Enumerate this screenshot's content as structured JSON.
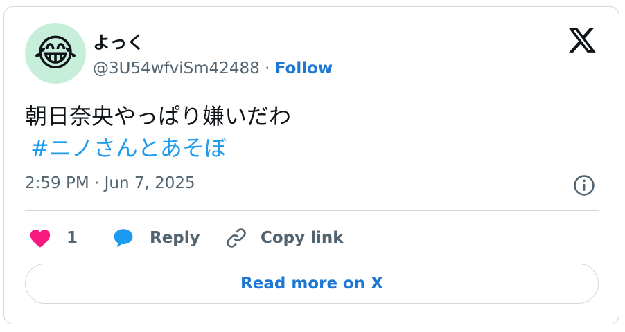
{
  "author": {
    "avatar_emoji": "😂",
    "avatar_bg": "#c6eedb",
    "display_name": "よっく",
    "handle": "@3U54wfviSm42488",
    "separator": " · ",
    "follow_label": "Follow"
  },
  "tweet": {
    "text": "朝日奈央やっぱり嫌いだわ",
    "hashtag": "#ニノさんとあそぼ",
    "timestamp": "2:59 PM · Jun 7, 2025"
  },
  "actions": {
    "like_count": "1",
    "reply_label": "Reply",
    "copy_link_label": "Copy link"
  },
  "footer": {
    "read_more_label": "Read more on X"
  },
  "icons": {
    "brand": "x-logo-icon",
    "info": "info-icon",
    "like": "heart-icon",
    "reply": "speech-bubble-icon",
    "copy": "link-icon"
  },
  "colors": {
    "like": "#f91880",
    "reply": "#1d9bf0",
    "link": "#1d77d4",
    "hashtag": "#1d9bf0",
    "muted": "#536471",
    "border": "#cfd9de"
  }
}
